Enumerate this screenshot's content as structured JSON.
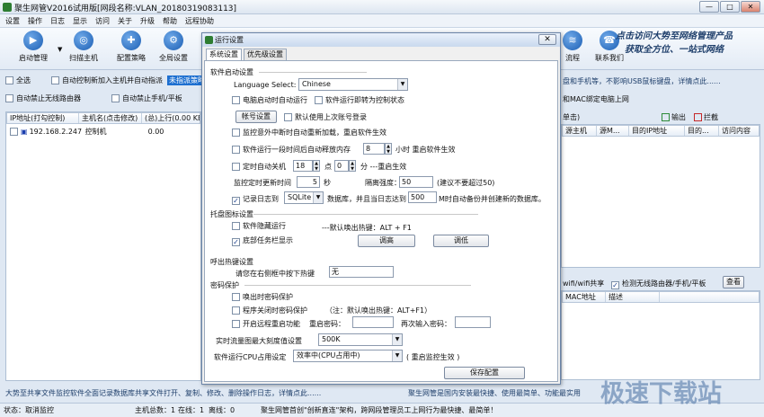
{
  "window": {
    "title": "聚生网管V2016试用版[网段名称:VLAN_20180319083113]",
    "min": "—",
    "max": "□",
    "close": "✕"
  },
  "menu": [
    "设置",
    "操作",
    "日志",
    "显示",
    "访问",
    "关于",
    "升级",
    "帮助",
    "远程协助"
  ],
  "toolbar": {
    "start": "启动管理",
    "scan": "扫描主机",
    "policy": "配置策略",
    "global": "全局设置",
    "flow": "流程",
    "contact": "联系我们"
  },
  "slogan": {
    "line1": "点击访问大势至网络管理产品",
    "line2": "获取全方位、一站式网络"
  },
  "options": {
    "select_all": "全选",
    "auto_control": "自动控制新加入主机并自动指派",
    "assign": "未指派策略",
    "auto_wifi": "自动禁止无线路由器",
    "auto_phone": "自动禁止手机/平板"
  },
  "right_hints": {
    "hint1": "盘和手机等，不影响USB鼠标键盘，详情点此......",
    "hint2": "和MAC绑定电脑上网"
  },
  "main_headers": [
    "IP地址(打勾控制)",
    "主机名(点击修改)",
    "(总)上行(0.00 KB"
  ],
  "host_row": {
    "ip": "192.168.2.247",
    "name": "控制机",
    "up": "0.00"
  },
  "right_headers": [
    "源主机",
    "源M...",
    "目的IP地址",
    "目的...",
    "访问内容"
  ],
  "legend": {
    "label": "单击)",
    "out": "输出",
    "block": "拦截"
  },
  "wifi_bar": {
    "share": "wifi/wifi共享",
    "detect": "检测无线路由器/手机/平板",
    "view": "查看"
  },
  "mac_headers": [
    "MAC地址",
    "描述"
  ],
  "bottom_left": "大势至共享文件监控软件全面记录数据库共享文件打开、复制、修改、删除操作日志，详情点此......",
  "bottom_right": "聚生网管是国内安装最快捷、使用最简单、功能最实用",
  "status": {
    "state": "状态：取消监控",
    "hosts": "主机总数：1",
    "online": "在线：1",
    "offline": "离线：0",
    "slogan": "聚生网管首创\"创新直连\"架构，跨网段管理员工上网行为最快捷、最简单！"
  },
  "dialog": {
    "title": "运行设置",
    "tabs": [
      "系统设置",
      "优先级设置"
    ],
    "startup_section": "软件启动设置",
    "lang_label": "Language Select:",
    "lang_value": "Chinese",
    "autorun": "电脑启动时自动运行",
    "tray_on_run": "软件运行即转为控制状态",
    "account_button": "帐号设置",
    "last_account": "默认使用上次账号登录",
    "reload_on_interrupt": "监控意外中断时自动重新加载，重启软件生效",
    "free_mem_prefix": "软件运行一段时间后自动释放内存",
    "free_mem_value": "8",
    "free_mem_suffix": "小时 重启软件生效",
    "shutdown_label": "定时自动关机",
    "shutdown_hour": "18",
    "shutdown_hour_unit": "点",
    "shutdown_min": "0",
    "shutdown_min_unit": "分 ---重启生效",
    "monitor_update_label": "监控定时更新时间",
    "monitor_update_value": "5",
    "monitor_update_unit": "秒",
    "interval_label": "隔离强度：",
    "interval_value": "50",
    "interval_hint": "(建议不要超过50)",
    "log_prefix": "记录日志到",
    "log_db": "SQLite",
    "log_mid": "数据库，并且当日志达到",
    "log_size": "500",
    "log_suffix": "M时自动备份并创建新的数据库。",
    "tray_section": "托盘图标设置",
    "hide_run": "软件隐藏运行",
    "hotkey_default": "---默认唤出热键：ALT + F1",
    "taskbar_show": "底部任务栏显示",
    "raise_btn": "调高",
    "lower_btn": "调低",
    "hotkey_section": "呼出热键设置",
    "hotkey_prompt": "请您在右侧框中按下热键",
    "hotkey_value": "无",
    "password_section": "密码保护",
    "pwd_on_call": "唤出时密码保护",
    "pwd_on_close": "程序关闭时密码保护",
    "pwd_close_note": "（注：默认唤出热键：ALT+F1）",
    "remote_restart": "开启远程重启功能",
    "restart_pwd": "重启密码：",
    "restart_pwd_again": "再次输入密码：",
    "flow_label": "实时流量图最大刻度值设置",
    "flow_value": "500K",
    "cpu_label": "软件运行CPU占用设定",
    "cpu_value": "效率中(CPU占用中)",
    "cpu_hint": "( 重启监控生效 )",
    "save": "保存配置"
  },
  "watermark": "极速下载站"
}
